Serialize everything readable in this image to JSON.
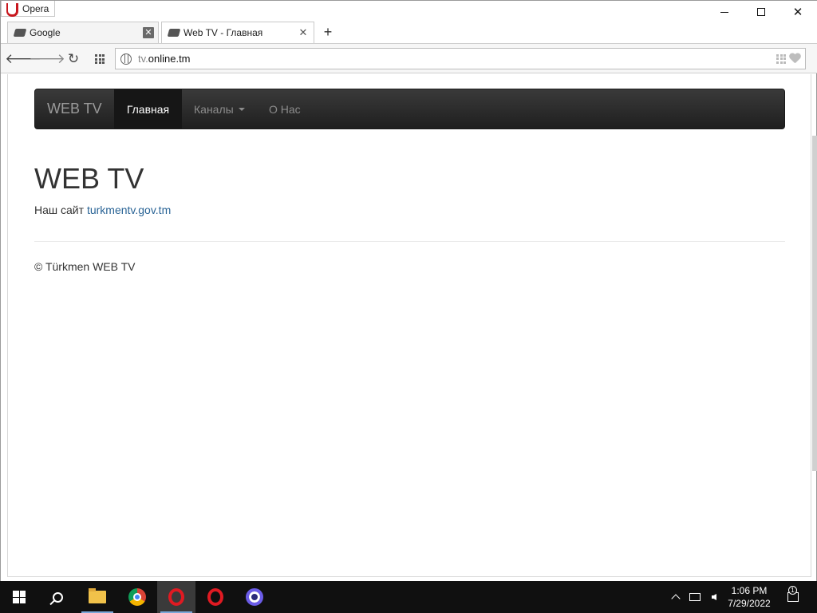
{
  "window": {
    "app_menu_label": "Opera"
  },
  "tabs": [
    {
      "title": "Google",
      "active": false
    },
    {
      "title": "Web TV - Главная",
      "active": true
    }
  ],
  "toolbar": {
    "url_subdomain": "tv.",
    "url_domain": "online.tm"
  },
  "page": {
    "navbar": {
      "brand": "WEB TV",
      "items": [
        {
          "label": "Главная",
          "active": true
        },
        {
          "label": "Каналы",
          "dropdown": true
        },
        {
          "label": "О Нас"
        }
      ]
    },
    "heading": "WEB TV",
    "site_prefix": "Наш сайт",
    "site_link": "turkmentv.gov.tm",
    "footer": "© Türkmen WEB TV",
    "colors": {
      "navbar": "#222222",
      "link": "#2a6496",
      "text": "#333333"
    }
  },
  "taskbar": {
    "apps": [
      "start-icon",
      "search-icon",
      "file-explorer-icon",
      "chrome-icon",
      "opera-icon",
      "opera-icon",
      "browser-icon"
    ],
    "time": "1:06 PM",
    "date": "7/29/2022",
    "notification_count": "1"
  }
}
